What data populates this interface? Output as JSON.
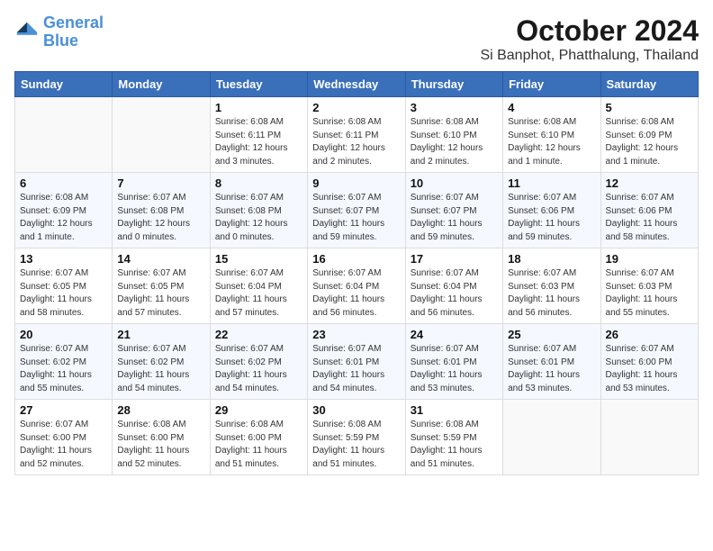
{
  "header": {
    "logo_line1": "General",
    "logo_line2": "Blue",
    "month_title": "October 2024",
    "location": "Si Banphot, Phatthalung, Thailand"
  },
  "days_of_week": [
    "Sunday",
    "Monday",
    "Tuesday",
    "Wednesday",
    "Thursday",
    "Friday",
    "Saturday"
  ],
  "weeks": [
    [
      {
        "day": "",
        "info": ""
      },
      {
        "day": "",
        "info": ""
      },
      {
        "day": "1",
        "info": "Sunrise: 6:08 AM\nSunset: 6:11 PM\nDaylight: 12 hours\nand 3 minutes."
      },
      {
        "day": "2",
        "info": "Sunrise: 6:08 AM\nSunset: 6:11 PM\nDaylight: 12 hours\nand 2 minutes."
      },
      {
        "day": "3",
        "info": "Sunrise: 6:08 AM\nSunset: 6:10 PM\nDaylight: 12 hours\nand 2 minutes."
      },
      {
        "day": "4",
        "info": "Sunrise: 6:08 AM\nSunset: 6:10 PM\nDaylight: 12 hours\nand 1 minute."
      },
      {
        "day": "5",
        "info": "Sunrise: 6:08 AM\nSunset: 6:09 PM\nDaylight: 12 hours\nand 1 minute."
      }
    ],
    [
      {
        "day": "6",
        "info": "Sunrise: 6:08 AM\nSunset: 6:09 PM\nDaylight: 12 hours\nand 1 minute."
      },
      {
        "day": "7",
        "info": "Sunrise: 6:07 AM\nSunset: 6:08 PM\nDaylight: 12 hours\nand 0 minutes."
      },
      {
        "day": "8",
        "info": "Sunrise: 6:07 AM\nSunset: 6:08 PM\nDaylight: 12 hours\nand 0 minutes."
      },
      {
        "day": "9",
        "info": "Sunrise: 6:07 AM\nSunset: 6:07 PM\nDaylight: 11 hours\nand 59 minutes."
      },
      {
        "day": "10",
        "info": "Sunrise: 6:07 AM\nSunset: 6:07 PM\nDaylight: 11 hours\nand 59 minutes."
      },
      {
        "day": "11",
        "info": "Sunrise: 6:07 AM\nSunset: 6:06 PM\nDaylight: 11 hours\nand 59 minutes."
      },
      {
        "day": "12",
        "info": "Sunrise: 6:07 AM\nSunset: 6:06 PM\nDaylight: 11 hours\nand 58 minutes."
      }
    ],
    [
      {
        "day": "13",
        "info": "Sunrise: 6:07 AM\nSunset: 6:05 PM\nDaylight: 11 hours\nand 58 minutes."
      },
      {
        "day": "14",
        "info": "Sunrise: 6:07 AM\nSunset: 6:05 PM\nDaylight: 11 hours\nand 57 minutes."
      },
      {
        "day": "15",
        "info": "Sunrise: 6:07 AM\nSunset: 6:04 PM\nDaylight: 11 hours\nand 57 minutes."
      },
      {
        "day": "16",
        "info": "Sunrise: 6:07 AM\nSunset: 6:04 PM\nDaylight: 11 hours\nand 56 minutes."
      },
      {
        "day": "17",
        "info": "Sunrise: 6:07 AM\nSunset: 6:04 PM\nDaylight: 11 hours\nand 56 minutes."
      },
      {
        "day": "18",
        "info": "Sunrise: 6:07 AM\nSunset: 6:03 PM\nDaylight: 11 hours\nand 56 minutes."
      },
      {
        "day": "19",
        "info": "Sunrise: 6:07 AM\nSunset: 6:03 PM\nDaylight: 11 hours\nand 55 minutes."
      }
    ],
    [
      {
        "day": "20",
        "info": "Sunrise: 6:07 AM\nSunset: 6:02 PM\nDaylight: 11 hours\nand 55 minutes."
      },
      {
        "day": "21",
        "info": "Sunrise: 6:07 AM\nSunset: 6:02 PM\nDaylight: 11 hours\nand 54 minutes."
      },
      {
        "day": "22",
        "info": "Sunrise: 6:07 AM\nSunset: 6:02 PM\nDaylight: 11 hours\nand 54 minutes."
      },
      {
        "day": "23",
        "info": "Sunrise: 6:07 AM\nSunset: 6:01 PM\nDaylight: 11 hours\nand 54 minutes."
      },
      {
        "day": "24",
        "info": "Sunrise: 6:07 AM\nSunset: 6:01 PM\nDaylight: 11 hours\nand 53 minutes."
      },
      {
        "day": "25",
        "info": "Sunrise: 6:07 AM\nSunset: 6:01 PM\nDaylight: 11 hours\nand 53 minutes."
      },
      {
        "day": "26",
        "info": "Sunrise: 6:07 AM\nSunset: 6:00 PM\nDaylight: 11 hours\nand 53 minutes."
      }
    ],
    [
      {
        "day": "27",
        "info": "Sunrise: 6:07 AM\nSunset: 6:00 PM\nDaylight: 11 hours\nand 52 minutes."
      },
      {
        "day": "28",
        "info": "Sunrise: 6:08 AM\nSunset: 6:00 PM\nDaylight: 11 hours\nand 52 minutes."
      },
      {
        "day": "29",
        "info": "Sunrise: 6:08 AM\nSunset: 6:00 PM\nDaylight: 11 hours\nand 51 minutes."
      },
      {
        "day": "30",
        "info": "Sunrise: 6:08 AM\nSunset: 5:59 PM\nDaylight: 11 hours\nand 51 minutes."
      },
      {
        "day": "31",
        "info": "Sunrise: 6:08 AM\nSunset: 5:59 PM\nDaylight: 11 hours\nand 51 minutes."
      },
      {
        "day": "",
        "info": ""
      },
      {
        "day": "",
        "info": ""
      }
    ]
  ]
}
